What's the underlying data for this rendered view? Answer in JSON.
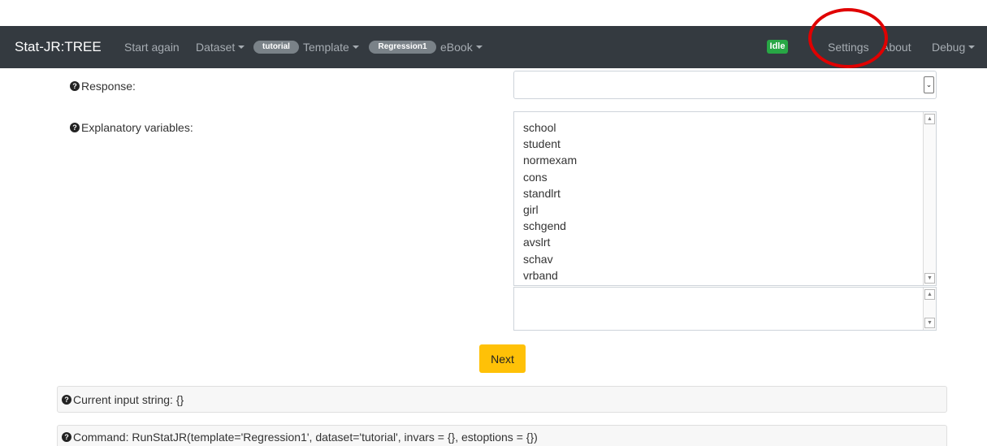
{
  "navbar": {
    "brand": "Stat-JR:TREE",
    "start_again": "Start again",
    "dataset_label": "Dataset",
    "dataset_badge": "tutorial",
    "template_label": "Template",
    "template_badge": "Regression1",
    "ebook_label": "eBook",
    "status": "Idle",
    "settings": "Settings",
    "about": "About",
    "debug": "Debug"
  },
  "form": {
    "response_label": "Response:",
    "response_value": "",
    "explanatory_label": "Explanatory variables:",
    "variables": [
      "school",
      "student",
      "normexam",
      "cons",
      "standlrt",
      "girl",
      "schgend",
      "avslrt",
      "schav",
      "vrband"
    ],
    "extra_text": "",
    "next_label": "Next"
  },
  "info": {
    "input_string": "Current input string: {}",
    "command": "Command: RunStatJR(template='Regression1', dataset='tutorial', invars = {}, estoptions = {})"
  },
  "colors": {
    "navbar_bg": "#343a40",
    "next_button": "#ffc107",
    "idle_badge": "#28a745",
    "highlight_circle": "#e00000"
  }
}
